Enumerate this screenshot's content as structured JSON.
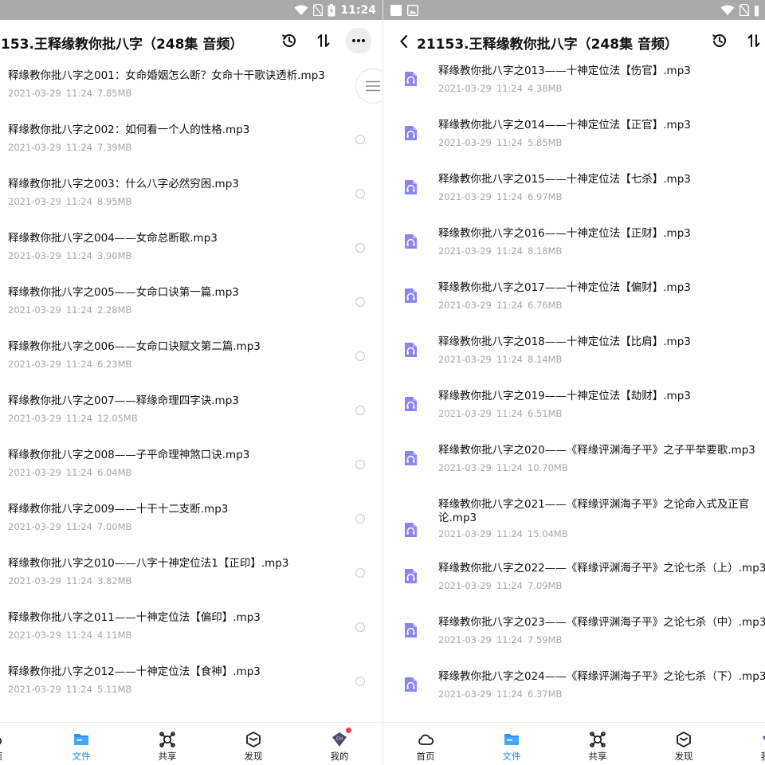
{
  "status_bar": {
    "time": "11:24",
    "background": "#aaaaaa"
  },
  "left": {
    "title": "153.王释缘教你批八字（248集 音频）",
    "files": [
      {
        "name": "释缘教你批八字之001：女命婚姻怎么断？女命十干歌诀透析.mp3",
        "date": "2021-03-29",
        "time": "11:24",
        "size": "7.85MB"
      },
      {
        "name": "释缘教你批八字之002：如何看一个人的性格.mp3",
        "date": "2021-03-29",
        "time": "11:24",
        "size": "7.39MB"
      },
      {
        "name": "释缘教你批八字之003：什么八字必然穷困.mp3",
        "date": "2021-03-29",
        "time": "11:24",
        "size": "8.95MB"
      },
      {
        "name": "释缘教你批八字之004——女命总断歌.mp3",
        "date": "2021-03-29",
        "time": "11:24",
        "size": "3.90MB"
      },
      {
        "name": "释缘教你批八字之005——女命口诀第一篇.mp3",
        "date": "2021-03-29",
        "time": "11:24",
        "size": "2.28MB"
      },
      {
        "name": "释缘教你批八字之006——女命口诀赋文第二篇.mp3",
        "date": "2021-03-29",
        "time": "11:24",
        "size": "6.23MB"
      },
      {
        "name": "释缘教你批八字之007——释缘命理四字诀.mp3",
        "date": "2021-03-29",
        "time": "11:24",
        "size": "12.05MB"
      },
      {
        "name": "释缘教你批八字之008——子平命理神煞口诀.mp3",
        "date": "2021-03-29",
        "time": "11:24",
        "size": "6.04MB"
      },
      {
        "name": "释缘教你批八字之009——十干十二支断.mp3",
        "date": "2021-03-29",
        "time": "11:24",
        "size": "7.00MB"
      },
      {
        "name": "释缘教你批八字之010——八字十神定位法1【正印】.mp3",
        "date": "2021-03-29",
        "time": "11:24",
        "size": "3.82MB"
      },
      {
        "name": "释缘教你批八字之011——十神定位法【偏印】.mp3",
        "date": "2021-03-29",
        "time": "11:24",
        "size": "4.11MB"
      },
      {
        "name": "释缘教你批八字之012——十神定位法【食神】.mp3",
        "date": "2021-03-29",
        "time": "11:24",
        "size": "5.11MB"
      }
    ],
    "nav": [
      {
        "label": "首页",
        "icon": "home-cloud-icon"
      },
      {
        "label": "文件",
        "icon": "folder-icon"
      },
      {
        "label": "共享",
        "icon": "share-icon"
      },
      {
        "label": "发现",
        "icon": "discover-icon"
      },
      {
        "label": "我的",
        "icon": "profile-icon"
      }
    ]
  },
  "right": {
    "title": "21153.王释缘教你批八字（248集 音频）",
    "files": [
      {
        "name": "释缘教你批八字之013——十神定位法【伤官】.mp3",
        "date": "2021-03-29",
        "time": "11:24",
        "size": "4.38MB"
      },
      {
        "name": "释缘教你批八字之014——十神定位法【正官】.mp3",
        "date": "2021-03-29",
        "time": "11:24",
        "size": "5.85MB"
      },
      {
        "name": "释缘教你批八字之015——十神定位法【七杀】.mp3",
        "date": "2021-03-29",
        "time": "11:24",
        "size": "6.97MB"
      },
      {
        "name": "释缘教你批八字之016——十神定位法【正财】.mp3",
        "date": "2021-03-29",
        "time": "11:24",
        "size": "8.18MB"
      },
      {
        "name": "释缘教你批八字之017——十神定位法【偏财】.mp3",
        "date": "2021-03-29",
        "time": "11:24",
        "size": "6.76MB"
      },
      {
        "name": "释缘教你批八字之018——十神定位法【比肩】.mp3",
        "date": "2021-03-29",
        "time": "11:24",
        "size": "8.14MB"
      },
      {
        "name": "释缘教你批八字之019——十神定位法【劫财】.mp3",
        "date": "2021-03-29",
        "time": "11:24",
        "size": "6.51MB"
      },
      {
        "name": "释缘教你批八字之020——《释缘评渊海子平》之子平举要歌.mp3",
        "date": "2021-03-29",
        "time": "11:24",
        "size": "10.70MB"
      },
      {
        "name": "释缘教你批八字之021——《释缘评渊海子平》之论命入式及正官论.mp3",
        "date": "2021-03-29",
        "time": "11:24",
        "size": "15.04MB"
      },
      {
        "name": "释缘教你批八字之022——《释缘评渊海子平》之论七杀（上）.mp3",
        "date": "2021-03-29",
        "time": "11:24",
        "size": "7.09MB"
      },
      {
        "name": "释缘教你批八字之023——《释缘评渊海子平》之论七杀（中）.mp3",
        "date": "2021-03-29",
        "time": "11:24",
        "size": "7.59MB"
      },
      {
        "name": "释缘教你批八字之024——《释缘评渊海子平》之论七杀（下）.mp3",
        "date": "2021-03-29",
        "time": "11:24",
        "size": "6.37MB"
      }
    ],
    "nav": [
      {
        "label": "首页",
        "icon": "home-cloud-icon"
      },
      {
        "label": "文件",
        "icon": "folder-icon"
      },
      {
        "label": "共享",
        "icon": "share-icon"
      },
      {
        "label": "发现",
        "icon": "discover-icon"
      },
      {
        "label": "我的",
        "icon": "profile-icon"
      }
    ]
  },
  "colors": {
    "accent": "#1e8bff",
    "audio_icon": "#8b84f2",
    "meta_text": "#a8a8a8",
    "badge": "#f04050"
  }
}
